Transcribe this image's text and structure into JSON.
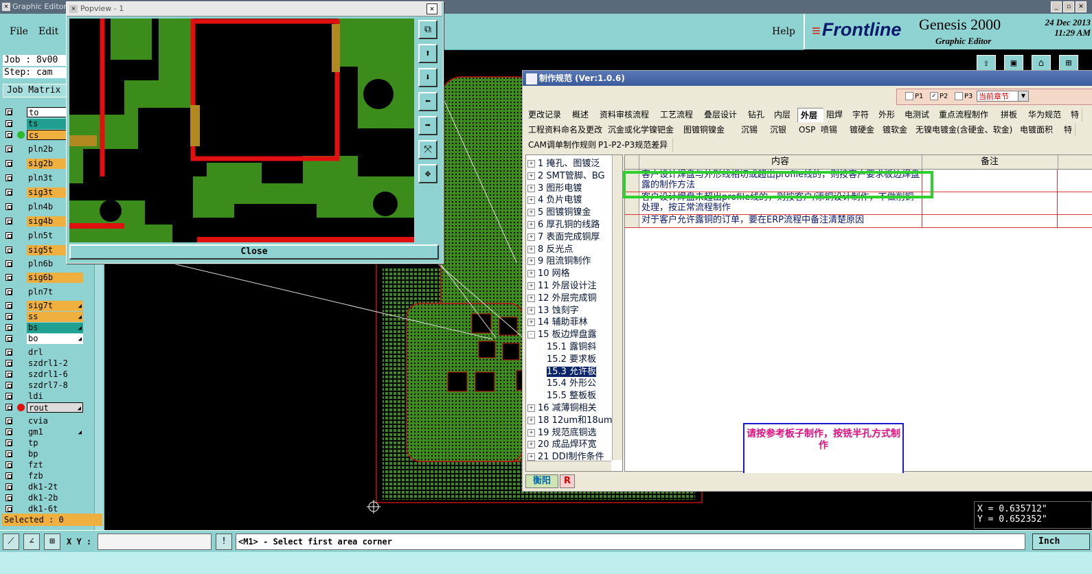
{
  "window": {
    "title": "Graphic Editor"
  },
  "menu": {
    "file": "File",
    "edit": "Edit",
    "help": "Help"
  },
  "brand": {
    "logo": "Frontline",
    "product": "Genesis 2000",
    "subtitle": "Graphic Editor",
    "date": "24 Dec 2013",
    "time": "11:29 AM"
  },
  "job": {
    "job_line": "Job : 8v00",
    "step_line": "Step: cam",
    "matrix_label": "Job Matrix"
  },
  "layers": [
    {
      "name": "to",
      "color": "#ffffff"
    },
    {
      "name": "ts",
      "color": "#20a090"
    },
    {
      "name": "cs",
      "color": "#f0b040"
    },
    {
      "name": "pln2b",
      "color": "#8fd2d2"
    },
    {
      "name": "sig2b",
      "color": "#f0b040"
    },
    {
      "name": "pln3t",
      "color": "#8fd2d2"
    },
    {
      "name": "sig3t",
      "color": "#f0b040"
    },
    {
      "name": "pln4b",
      "color": "#8fd2d2"
    },
    {
      "name": "sig4b",
      "color": "#f0b040"
    },
    {
      "name": "pln5t",
      "color": "#8fd2d2"
    },
    {
      "name": "sig5t",
      "color": "#f0b040"
    },
    {
      "name": "pln6b",
      "color": "#8fd2d2"
    },
    {
      "name": "sig6b",
      "color": "#f0b040"
    },
    {
      "name": "pln7t",
      "color": "#8fd2d2"
    },
    {
      "name": "sig7t",
      "color": "#f0b040"
    },
    {
      "name": "ss",
      "color": "#f0b040"
    },
    {
      "name": "bs",
      "color": "#20a090"
    },
    {
      "name": "bo",
      "color": "#ffffff"
    },
    {
      "name": "drl",
      "color": "#8fd2d2"
    },
    {
      "name": "szdrl1-2",
      "color": "#8fd2d2"
    },
    {
      "name": "szdrl1-6",
      "color": "#8fd2d2"
    },
    {
      "name": "szdrl7-8",
      "color": "#8fd2d2"
    },
    {
      "name": "ldi",
      "color": "#8fd2d2"
    },
    {
      "name": "rout",
      "color": "#dddddd"
    },
    {
      "name": "cvia",
      "color": "#8fd2d2"
    },
    {
      "name": "gm1",
      "color": "#8fd2d2"
    },
    {
      "name": "tp",
      "color": "#8fd2d2"
    },
    {
      "name": "bp",
      "color": "#8fd2d2"
    },
    {
      "name": "fzt",
      "color": "#8fd2d2"
    },
    {
      "name": "fzb",
      "color": "#8fd2d2"
    },
    {
      "name": "dk1-2t",
      "color": "#8fd2d2"
    },
    {
      "name": "dk1-2b",
      "color": "#8fd2d2"
    },
    {
      "name": "dk1-6t",
      "color": "#8fd2d2"
    }
  ],
  "selected_text": "Selected : 0",
  "bottom": {
    "xy_label": "X Y :",
    "prompt": "<M1> - Select first area corner",
    "unit": "Inch"
  },
  "coords": {
    "x": "X = 0.635712\"",
    "y": "Y = 0.652352\""
  },
  "popview": {
    "title": "Popview - 1",
    "close": "Close"
  },
  "spec": {
    "title": "制作规范 (Ver:1.0.6)",
    "p1": "P1",
    "p2": "P2",
    "p3": "P3",
    "chapter": "当前章节",
    "tabs_row1": [
      "更改记录",
      "概述",
      "资料审核流程",
      "工艺流程",
      "叠层设计",
      "钻孔",
      "内层",
      "外层",
      "阻焊",
      "字符",
      "外形",
      "电测试",
      "重点流程制作",
      "拼板",
      "华为规范",
      "特"
    ],
    "tabs_row2": [
      "工程资料命名及更改",
      "沉金或化学镍钯金",
      "图镀铜镍金",
      "沉锡",
      "沉银",
      "OSP",
      "喷锡",
      "镀硬金",
      "镀软金",
      "无镍电镀金(含硬金、软金)",
      "电镀面积",
      "特"
    ],
    "tabs_row3": [
      "CAM调单制作规则",
      "P1-P2-P3规范差异"
    ],
    "active_tab": "外层",
    "tree": [
      {
        "pm": "+",
        "label": "1  掩孔、图镀泛"
      },
      {
        "pm": "+",
        "label": "2  SMT管脚、BG"
      },
      {
        "pm": "+",
        "label": "3  图形电镀"
      },
      {
        "pm": "+",
        "label": "4  负片电镀"
      },
      {
        "pm": "+",
        "label": "5  图镀铜镍金"
      },
      {
        "pm": "+",
        "label": "6  厚孔铜的线路"
      },
      {
        "pm": "+",
        "label": "7  表面完成铜厚"
      },
      {
        "pm": "+",
        "label": "8  反光点"
      },
      {
        "pm": "+",
        "label": "9  阻流铜制作"
      },
      {
        "pm": "+",
        "label": "10  网格"
      },
      {
        "pm": "+",
        "label": "11  外层设计注"
      },
      {
        "pm": "+",
        "label": "12  外层完成铜"
      },
      {
        "pm": "+",
        "label": "13  蚀刻字"
      },
      {
        "pm": "+",
        "label": "14  辅助菲林"
      },
      {
        "pm": "-",
        "label": "15  板边焊盘露"
      },
      {
        "pm": "",
        "label": "15.1  露铜斜"
      },
      {
        "pm": "",
        "label": "15.2  要求板"
      },
      {
        "pm": "",
        "label": "15.3  允许板"
      },
      {
        "pm": "",
        "label": "15.4  外形公"
      },
      {
        "pm": "",
        "label": "15.5  整板板"
      },
      {
        "pm": "+",
        "label": "16  减薄铜相关"
      },
      {
        "pm": "+",
        "label": "18  12um和18um"
      },
      {
        "pm": "+",
        "label": "19  规范底铜选"
      },
      {
        "pm": "+",
        "label": "20  成品焊环宽"
      },
      {
        "pm": "+",
        "label": "21  DDI制作条件"
      }
    ],
    "grid_head": {
      "content": "内容",
      "remark": "备注"
    },
    "rows": [
      "客户设计焊盘与外形线相切或超出profile线的，则按客户要求板边焊盘露的制作方法",
      "客户设计焊盘未超出profile线的，则按客户/添铜设计制作，不做削铜处理，按正常流程制作",
      "对于客户允许露铜的订单，要在ERP流程中备注清楚原因"
    ],
    "note": "请按参考板子制作，按铣半孔方式制作",
    "foot_a": "衡阳",
    "foot_b": "R"
  }
}
